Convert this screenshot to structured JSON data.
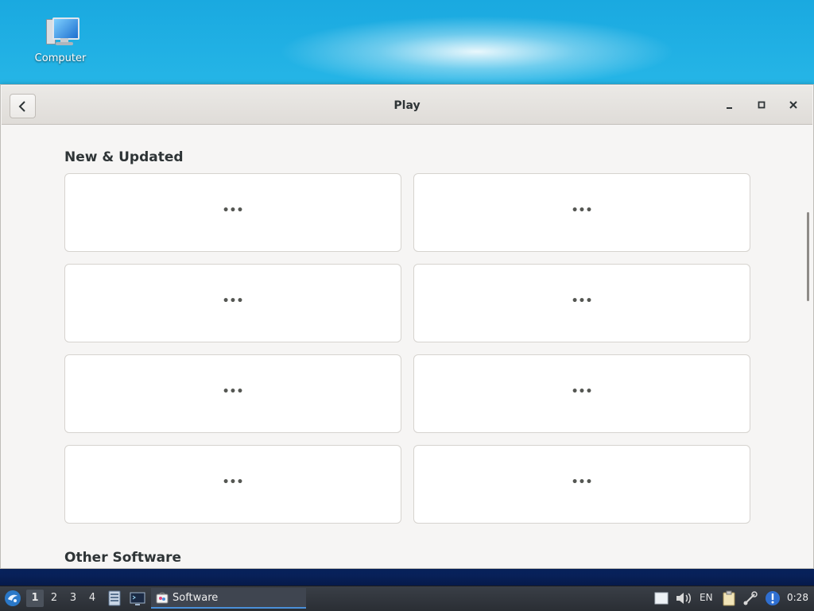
{
  "desktop": {
    "icons": [
      {
        "label": "Computer",
        "icon": "computer-icon"
      }
    ]
  },
  "window": {
    "title": "Play",
    "back_icon": "chevron-left-icon",
    "controls": {
      "minimize": "minimize-icon",
      "maximize": "maximize-icon",
      "close": "close-icon"
    }
  },
  "sections": [
    {
      "title": "New & Updated",
      "tiles": [
        "•••",
        "•••",
        "•••",
        "•••",
        "•••",
        "•••",
        "•••",
        "•••"
      ]
    },
    {
      "title": "Other Software"
    }
  ],
  "taskbar": {
    "start_icon": "lxqt-menu-icon",
    "workspaces": [
      "1",
      "2",
      "3",
      "4"
    ],
    "active_workspace": "1",
    "launchers": [
      "file-manager-icon",
      "terminal-icon"
    ],
    "tasks": [
      {
        "label": "Software",
        "icon": "software-center-icon"
      }
    ],
    "tray": {
      "icons": [
        "notes-icon",
        "volume-icon",
        "clipboard-icon",
        "network-icon",
        "update-alert-icon"
      ],
      "keyboard_layout": "EN",
      "clock": "0:28"
    }
  },
  "colors": {
    "window_bg": "#f6f5f4",
    "tile_bg": "#ffffff",
    "panel_bg": "#2f343b",
    "task_highlight": "#4a90d9"
  }
}
